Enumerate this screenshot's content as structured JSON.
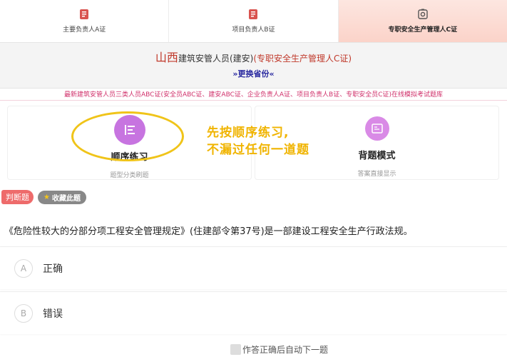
{
  "tabs": [
    {
      "label": "主要负责人A证",
      "icon": "document-icon",
      "active": false
    },
    {
      "label": "项目负责人B证",
      "icon": "document-icon",
      "active": false
    },
    {
      "label": "专职安全生产管理人C证",
      "icon": "exam-icon",
      "active": true
    }
  ],
  "header": {
    "province": "山西",
    "title_main": "建筑安管人员(建安)",
    "title_cat": "(专职安全生产管理人C证)",
    "switch_label": "»更换省份«"
  },
  "marquee": "最新建筑安管人员三类人员ABC证(安全员ABC证、建安ABC证、企业负责人A证、项目负责人B证、专职安全员C证)在线模拟考试题库",
  "modes": [
    {
      "title": "顺序练习",
      "subtitle": "题型分类刷题",
      "icon": "list-icon"
    },
    {
      "title": "背题模式",
      "subtitle": "答案直接显示",
      "icon": "book-icon"
    }
  ],
  "tip": {
    "line1": "先按顺序练习,",
    "line2": "不漏过任何一道题"
  },
  "tags": {
    "type": "判断题",
    "favorite": "收藏此题"
  },
  "question": "《危险性较大的分部分项工程安全管理规定》(住建部令第37号)是一部建设工程安全生产行政法规。",
  "options": [
    {
      "letter": "A",
      "text": "正确"
    },
    {
      "letter": "B",
      "text": "错误"
    }
  ],
  "auto_next": "作答正确后自动下一题",
  "colors": {
    "accent_red": "#c0392b",
    "mode_purple": "#c774e0",
    "tip_yellow": "#f0b400",
    "tag_red": "#ee6b6b"
  }
}
